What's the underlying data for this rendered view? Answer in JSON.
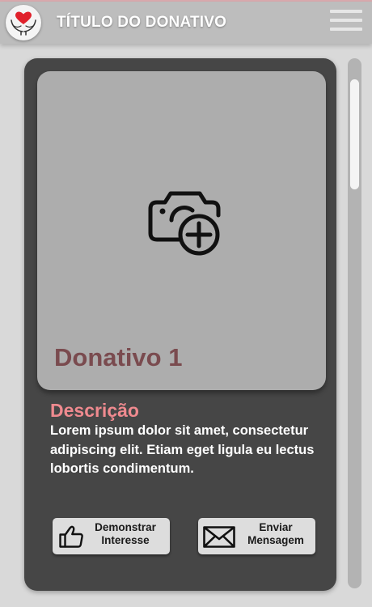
{
  "header": {
    "title": "TÍTULO DO DONATIVO",
    "logo_icon": "hands-heart-icon",
    "menu_icon": "hamburger-menu-icon"
  },
  "donation": {
    "photo_icon": "add-photo-camera-icon",
    "name": "Donativo 1",
    "description_label": "Descrição",
    "description": "Lorem ipsum dolor sit amet, consectetur adipiscing elit. Etiam eget ligula eu lectus lobortis condimentum."
  },
  "actions": {
    "interest": {
      "icon": "thumbs-up-icon",
      "label_line1": "Demonstrar",
      "label_line2": "Interesse"
    },
    "message": {
      "icon": "envelope-icon",
      "label_line1": "Enviar",
      "label_line2": "Mensagem"
    }
  },
  "colors": {
    "accent": "#ef8a8f",
    "heart": "#e0212b",
    "card": "#464646",
    "header": "#bdbdbd"
  }
}
